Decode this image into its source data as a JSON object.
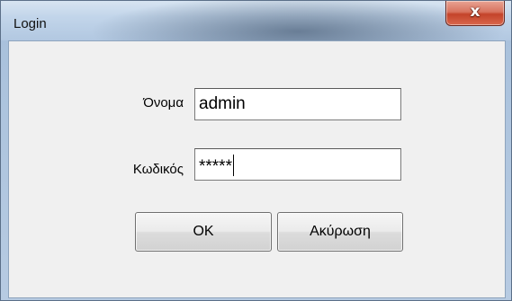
{
  "window": {
    "title": "Login",
    "close_glyph": "x"
  },
  "form": {
    "name_label": "Όνομα",
    "name_value": "admin",
    "password_label": "Κωδικός",
    "password_value": "*****"
  },
  "buttons": {
    "ok_label": "OK",
    "cancel_label": "Ακύρωση"
  },
  "colors": {
    "close_button": "#c4432a",
    "title_bar": "#b2c8e1",
    "client_bg": "#f0f0f0"
  }
}
